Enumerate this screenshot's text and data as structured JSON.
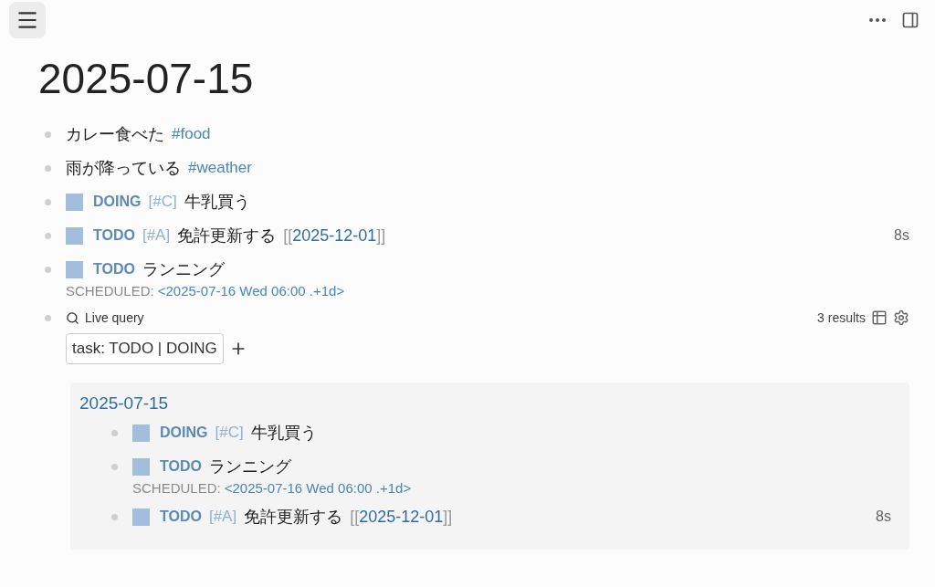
{
  "page_title": "2025-07-15",
  "blocks": [
    {
      "kind": "text",
      "text": "カレー食べた",
      "tag": "#food"
    },
    {
      "kind": "text",
      "text": "雨が降っている",
      "tag": "#weather"
    },
    {
      "kind": "task",
      "checked": false,
      "marker": "DOING",
      "priority": "[#C]",
      "text": "牛乳買う"
    },
    {
      "kind": "task",
      "checked": false,
      "marker": "TODO",
      "priority": "[#A]",
      "text": "免許更新する",
      "page_ref": {
        "open": "[[",
        "title": "2025-12-01",
        "close": "]]"
      },
      "timer": "8s"
    },
    {
      "kind": "task",
      "checked": false,
      "marker": "TODO",
      "text": "ランニング",
      "scheduled": {
        "label": "SCHEDULED:",
        "value": "<2025-07-16 Wed 06:00 .+1d>"
      }
    },
    {
      "kind": "query",
      "label": "Live query",
      "count": "3 results",
      "filter": "task: TODO | DOING",
      "results": {
        "page": "2025-07-15",
        "items": [
          {
            "kind": "task",
            "checked": false,
            "marker": "DOING",
            "priority": "[#C]",
            "text": "牛乳買う"
          },
          {
            "kind": "task",
            "checked": false,
            "marker": "TODO",
            "text": "ランニング",
            "scheduled": {
              "label": "SCHEDULED:",
              "value": "<2025-07-16 Wed 06:00 .+1d>"
            }
          },
          {
            "kind": "task",
            "checked": false,
            "marker": "TODO",
            "priority": "[#A]",
            "text": "免許更新する",
            "page_ref": {
              "open": "[[",
              "title": "2025-12-01",
              "close": "]]"
            },
            "timer": "8s"
          }
        ]
      }
    }
  ]
}
